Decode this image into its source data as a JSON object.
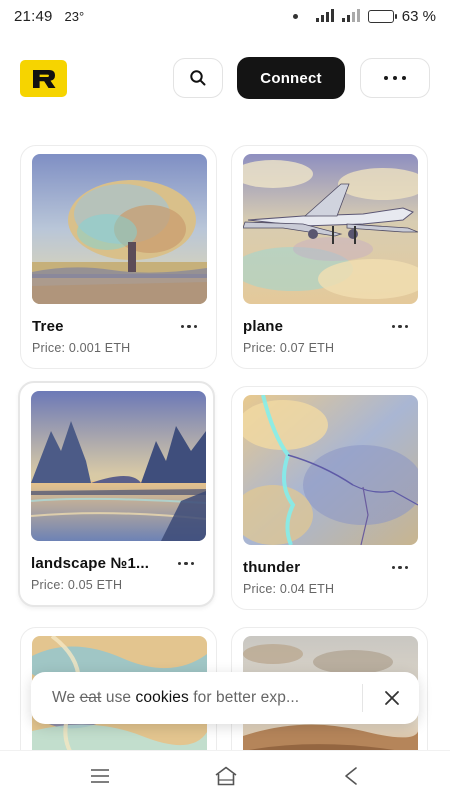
{
  "status_bar": {
    "time": "21:49",
    "temperature": "23°",
    "battery_percent": "63 %",
    "battery_level": 0.63
  },
  "header": {
    "logo_letter": "R",
    "connect_label": "Connect",
    "icons": {
      "search": "search-icon",
      "more": "more-horizontal-icon"
    },
    "colors": {
      "logo_bg": "#f6d400",
      "connect_bg": "#141414"
    }
  },
  "cards": [
    {
      "title": "Tree",
      "price": "Price: 0.001 ETH"
    },
    {
      "title": "plane",
      "price": "Price: 0.07 ETH"
    },
    {
      "title": "landscape №1...",
      "price": "Price: 0.05 ETH"
    },
    {
      "title": "thunder",
      "price": "Price: 0.04 ETH"
    },
    {
      "title": "",
      "price": ""
    },
    {
      "title": "",
      "price": ""
    }
  ],
  "cookie_banner": {
    "text_1": "We ",
    "text_struck": "eat",
    "text_2": " use ",
    "text_bold": "cookies",
    "text_3": " for better exp...",
    "close_icon": "close-icon"
  },
  "navbar": {
    "icons": [
      "menu-icon",
      "home-icon",
      "back-icon"
    ]
  }
}
